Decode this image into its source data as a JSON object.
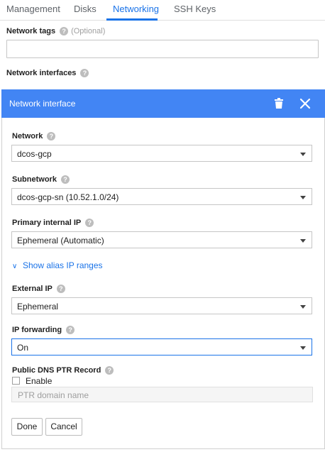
{
  "tabs": [
    {
      "label": "Management",
      "active": false
    },
    {
      "label": "Disks",
      "active": false
    },
    {
      "label": "Networking",
      "active": true
    },
    {
      "label": "SSH Keys",
      "active": false
    }
  ],
  "network_tags": {
    "label": "Network tags",
    "optional": "(Optional)",
    "value": ""
  },
  "network_interfaces": {
    "label": "Network interfaces"
  },
  "panel": {
    "title": "Network interface",
    "network": {
      "label": "Network",
      "value": "dcos-gcp"
    },
    "subnetwork": {
      "label": "Subnetwork",
      "value": "dcos-gcp-sn (10.52.1.0/24)"
    },
    "primary_ip": {
      "label": "Primary internal IP",
      "value": "Ephemeral (Automatic)"
    },
    "alias_link": "Show alias IP ranges",
    "external_ip": {
      "label": "External IP",
      "value": "Ephemeral"
    },
    "ip_forwarding": {
      "label": "IP forwarding",
      "value": "On"
    },
    "dns_ptr": {
      "label": "Public DNS PTR Record",
      "enable_label": "Enable",
      "placeholder": "PTR domain name"
    },
    "done_label": "Done",
    "cancel_label": "Cancel"
  },
  "colors": {
    "accent": "#4285f4",
    "link": "#1a73e8"
  }
}
